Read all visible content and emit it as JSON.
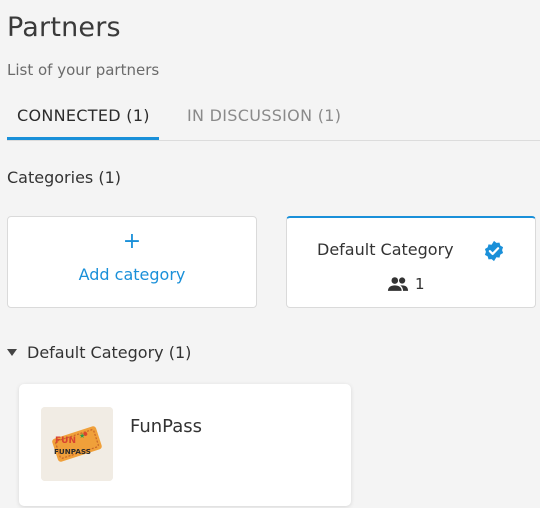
{
  "header": {
    "title": "Partners",
    "subtitle": "List of your partners"
  },
  "tabs": [
    {
      "label": "CONNECTED (1)",
      "active": true
    },
    {
      "label": "IN DISCUSSION (1)",
      "active": false
    }
  ],
  "categories": {
    "heading": "Categories (1)",
    "add_card": {
      "icon": "+",
      "label": "Add category"
    },
    "default_card": {
      "name": "Default Category",
      "verified_icon": "verified-badge-icon",
      "members_icon": "people-icon",
      "member_count": "1"
    }
  },
  "section": {
    "label": "Default Category (1)",
    "caret_icon": "caret-down-icon"
  },
  "partners": [
    {
      "name": "FunPass",
      "logo_text": "FUNPASS"
    }
  ],
  "colors": {
    "accent": "#1a90d9",
    "background": "#f4f4f4"
  }
}
